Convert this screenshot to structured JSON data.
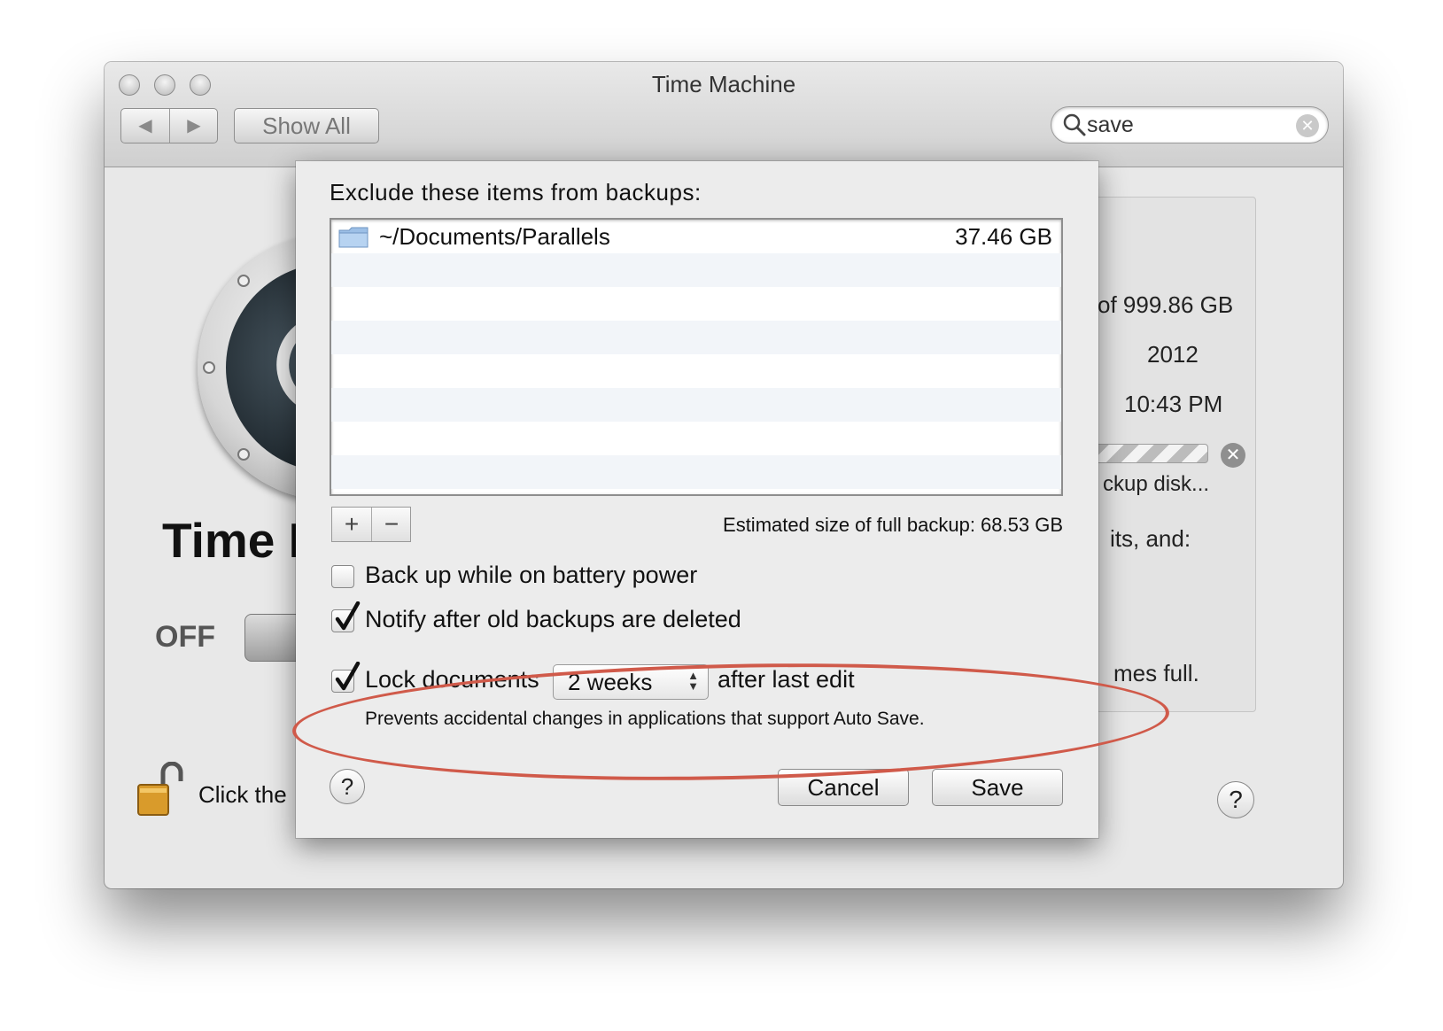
{
  "window": {
    "title": "Time Machine",
    "toolbar": {
      "back_glyph": "◀",
      "forward_glyph": "▶",
      "show_all_label": "Show All",
      "search_value": "save",
      "search_placeholder": "Search",
      "search_icon": "magnifier-icon",
      "clear_icon": "clear-icon"
    }
  },
  "pane": {
    "title_visible": "Time M",
    "toggle_state_label": "OFF",
    "lock_text_visible": "Click the",
    "right_panel": {
      "line1": "of 999.86 GB",
      "line2": "2012",
      "line3": "10:43 PM",
      "line4": "ckup disk...",
      "line5": "its, and:",
      "line6": "mes full."
    }
  },
  "sheet": {
    "exclude_label": "Exclude these items from backups:",
    "excluded_items": [
      {
        "path": "~/Documents/Parallels",
        "size": "37.46 GB",
        "icon": "folder-icon"
      }
    ],
    "add_label": "+",
    "remove_label": "−",
    "estimated_size_text": "Estimated size of full backup: 68.53 GB",
    "options": {
      "battery": {
        "label": "Back up while on battery power",
        "checked": false
      },
      "notify": {
        "label": "Notify after old backups are deleted",
        "checked": true
      },
      "lock": {
        "label_before": "Lock documents",
        "period_value": "2 weeks",
        "label_after": "after last edit",
        "checked": true,
        "note": "Prevents accidental changes in applications that support Auto Save."
      }
    },
    "help_label": "?",
    "cancel_label": "Cancel",
    "save_label": "Save"
  },
  "help_label": "?",
  "colors": {
    "annotation": "#d05a4a",
    "sheet_bg": "#ececec",
    "window_bg": "#e8e8e8"
  }
}
